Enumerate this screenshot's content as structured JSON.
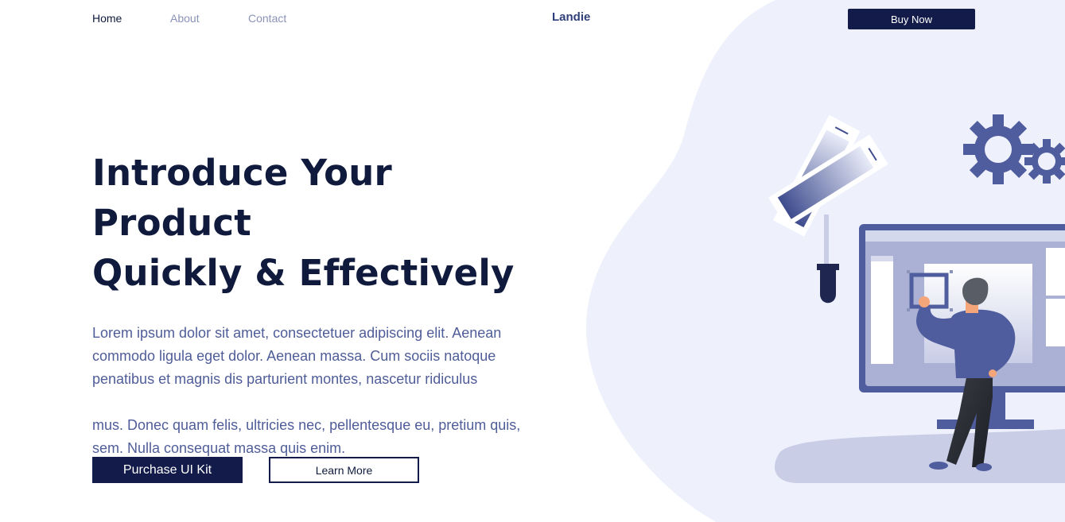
{
  "nav": {
    "home": "Home",
    "about": "About",
    "contact": "Contact",
    "logo": "Landie",
    "buy_now": "Buy Now"
  },
  "hero": {
    "title_line1": "Introduce Your Product",
    "title_line2": "Quickly & Effectively",
    "paragraph1": "Lorem ipsum dolor sit amet, consectetuer adipiscing elit. Aenean commodo ligula eget dolor. Aenean massa. Cum sociis natoque penatibus et magnis dis parturient montes, nascetur ridiculus",
    "paragraph2": "mus. Donec quam felis, ultricies nec, pellentesque eu, pretium quis, sem. Nulla consequat massa quis enim.",
    "primary_button": "Purchase UI Kit",
    "secondary_button": "Learn More"
  },
  "colors": {
    "navy": "#121b4a",
    "text_muted": "#4f5d98",
    "blob": "#eef1fc",
    "accent": "#4f5d9e"
  },
  "icons": [
    "gear-icon",
    "color-swatch-icon",
    "eyedropper-icon",
    "monitor-icon",
    "person-figure"
  ]
}
